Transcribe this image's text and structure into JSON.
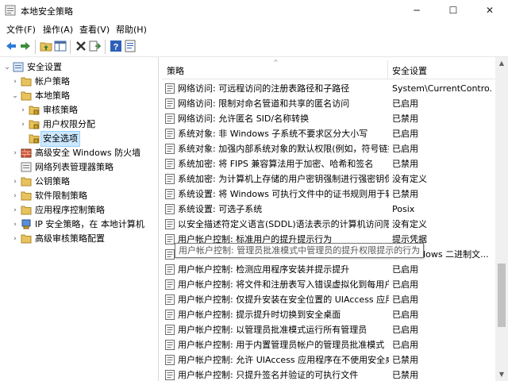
{
  "window": {
    "title": "本地安全策略",
    "minimize_glyph": "─",
    "maximize_glyph": "☐",
    "close_glyph": "✕"
  },
  "menu": [
    "文件(F)",
    "操作(A)",
    "查看(V)",
    "帮助(H)"
  ],
  "toolbar": {
    "icons": [
      "back-arrow-icon",
      "forward-arrow-icon",
      "up-folder-icon",
      "show-hide-tree-icon",
      "delete-icon",
      "export-list-icon",
      "help-icon",
      "properties-icon"
    ]
  },
  "tree": [
    {
      "label": "安全设置",
      "expander": "⌄",
      "level": 0
    },
    {
      "label": "帐户策略",
      "expander": "›",
      "level": 1
    },
    {
      "label": "本地策略",
      "expander": "⌄",
      "level": 1
    },
    {
      "label": "审核策略",
      "expander": "›",
      "level": 2
    },
    {
      "label": "用户权限分配",
      "expander": "›",
      "level": 2
    },
    {
      "label": "安全选项",
      "expander": "",
      "level": 2,
      "selected": true
    },
    {
      "label": "高级安全 Windows 防火墙",
      "expander": "›",
      "level": 1
    },
    {
      "label": "网络列表管理器策略",
      "expander": "",
      "level": 1
    },
    {
      "label": "公钥策略",
      "expander": "›",
      "level": 1
    },
    {
      "label": "软件限制策略",
      "expander": "›",
      "level": 1
    },
    {
      "label": "应用程序控制策略",
      "expander": "›",
      "level": 1
    },
    {
      "label": "IP 安全策略，在 本地计算机",
      "expander": "›",
      "level": 1
    },
    {
      "label": "高级审核策略配置",
      "expander": "›",
      "level": 1
    }
  ],
  "list": {
    "col_policy": "策略",
    "col_setting": "安全设置",
    "sort_glyph": "^",
    "rows": [
      {
        "policy": "网络访问: 可远程访问的注册表路径和子路径",
        "value": "System\\CurrentContro..."
      },
      {
        "policy": "网络访问: 限制对命名管道和共享的匿名访问",
        "value": "已启用"
      },
      {
        "policy": "网络访问: 允许匿名 SID/名称转换",
        "value": "已禁用"
      },
      {
        "policy": "系统对象: 非 Windows 子系统不要求区分大小写",
        "value": "已启用"
      },
      {
        "policy": "系统对象: 加强内部系统对象的默认权限(例如，符号链接)",
        "value": "已启用"
      },
      {
        "policy": "系统加密: 将 FIPS 兼容算法用于加密、哈希和签名",
        "value": "已禁用"
      },
      {
        "policy": "系统加密: 为计算机上存储的用户密钥强制进行强密钥保护",
        "value": "没有定义"
      },
      {
        "policy": "系统设置: 将 Windows 可执行文件中的证书规则用于软件...",
        "value": "已禁用"
      },
      {
        "policy": "系统设置: 可选子系统",
        "value": "Posix"
      },
      {
        "policy": "以安全描述符定义语言(SDDL)语法表示的计算机访问限制",
        "value": "没有定义"
      },
      {
        "policy": "用户帐户控制: 标准用户的提升提示行为",
        "value": "提示凭据"
      },
      {
        "policy": "",
        "value": "非 Windows 二进制文..."
      },
      {
        "policy": "用户帐户控制: 检测应用程序安装并提示提升",
        "value": "已启用"
      },
      {
        "policy": "用户帐户控制: 将文件和注册表写入错误虚拟化到每用户位置",
        "value": "已启用"
      },
      {
        "policy": "用户帐户控制: 仅提升安装在安全位置的 UIAccess 应用程序",
        "value": "已启用"
      },
      {
        "policy": "用户帐户控制: 提示提升时切换到安全桌面",
        "value": "已启用"
      },
      {
        "policy": "用户帐户控制: 以管理员批准模式运行所有管理员",
        "value": "已启用"
      },
      {
        "policy": "用户帐户控制: 用于内置管理员帐户的管理员批准模式",
        "value": "已启用"
      },
      {
        "policy": "用户帐户控制: 允许 UIAccess 应用程序在不使用安全桌面...",
        "value": "已禁用"
      },
      {
        "policy": "用户帐户控制: 只提升签名并验证的可执行文件",
        "value": "已禁用"
      }
    ]
  },
  "tooltip": "用户帐户控制: 管理员批准模式中管理员的提升权限提示的行为",
  "colors": {
    "selection": "#cce8ff",
    "folder": "#e8c25c",
    "back_arrow": "#2e7bd6"
  }
}
